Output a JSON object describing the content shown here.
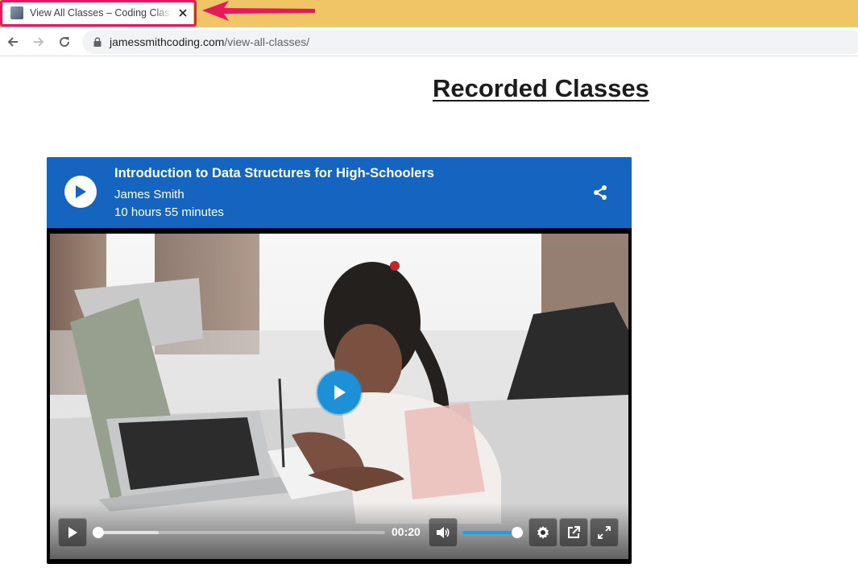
{
  "browser": {
    "tab": {
      "title": "View All Classes – Coding Classes",
      "favicon": "site-favicon",
      "close_icon": "close-icon"
    },
    "toolbar": {
      "back_icon": "back-arrow-icon",
      "forward_icon": "forward-arrow-icon",
      "reload_icon": "reload-icon"
    },
    "address": {
      "host": "jamessmithcoding.com",
      "path": "/view-all-classes/",
      "lock_icon": "lock-icon"
    },
    "highlight_color": "#e5195b",
    "tabstrip_color": "#f0c566"
  },
  "page": {
    "title": "Recorded Classes"
  },
  "player": {
    "header_color": "#1565c0",
    "title": "Introduction to Data Structures for High-Schoolers",
    "author": "James Smith",
    "duration": "10 hours 55 minutes",
    "current_time": "00:20",
    "progress_fraction": 0.0,
    "buffered_fraction": 0.21,
    "volume_fraction": 1.0,
    "accent_color": "#1ea0e8",
    "icons": [
      "play-icon",
      "share-icon",
      "volume-icon",
      "settings-icon",
      "popout-icon",
      "fullscreen-icon"
    ]
  }
}
